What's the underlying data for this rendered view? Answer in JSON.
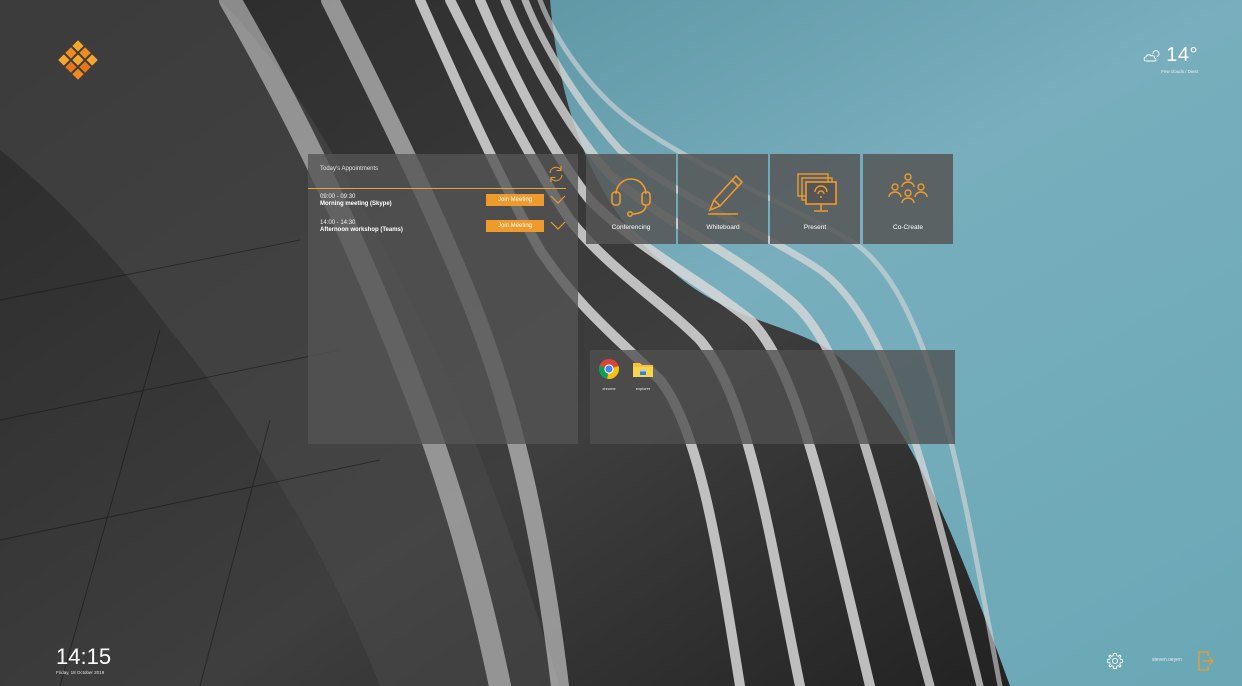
{
  "weather": {
    "icon": "partly-cloudy-icon",
    "temperature": "14°",
    "description": "Few clouds / Diest"
  },
  "appointments": {
    "header": "Today's Appointments",
    "items": [
      {
        "time": "09:00 - 09:30",
        "title": "Morning meeting (Skype)",
        "join_label": "Join Meeting"
      },
      {
        "time": "14:00 - 14:30",
        "title": "Afternoon workshop (Teams)",
        "join_label": "Join Meeting"
      }
    ]
  },
  "tiles": [
    {
      "label": "Conferencing",
      "icon": "headset-icon"
    },
    {
      "label": "Whiteboard",
      "icon": "pen-icon"
    },
    {
      "label": "Present",
      "icon": "present-screen-icon"
    },
    {
      "label": "Co-Create",
      "icon": "people-group-icon"
    }
  ],
  "apps": [
    {
      "label": "chrome",
      "icon": "chrome-icon"
    },
    {
      "label": "explorer",
      "icon": "folder-icon"
    }
  ],
  "clock": {
    "time": "14:15",
    "date": "Friday, 18 October 2019"
  },
  "user": {
    "name": "steven.oeyen"
  },
  "colors": {
    "accent": "#f09a2c",
    "panel": "#555555",
    "sky": "#6aa5b4"
  }
}
